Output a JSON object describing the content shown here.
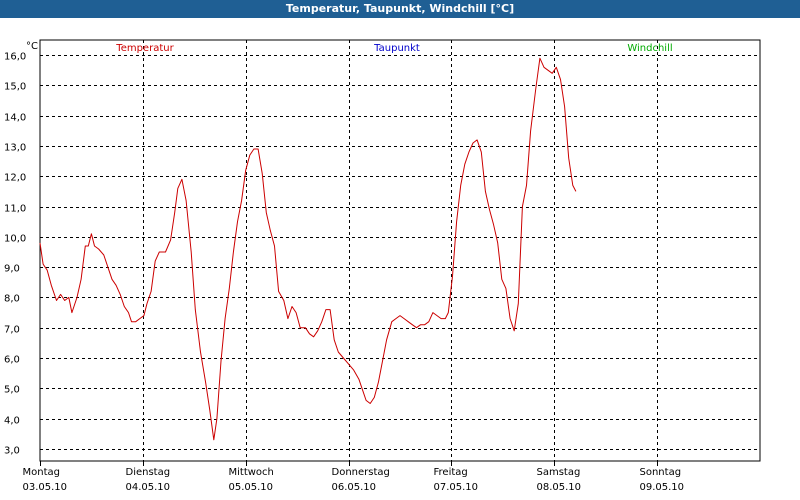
{
  "window": {
    "title": "Temperatur, Taupunkt, Windchill [°C]"
  },
  "colors": {
    "title_bar": "#1f5f94",
    "title_text": "#ffffff",
    "grid": "#000000",
    "temperatur": "#cc0000",
    "taupunkt": "#0000cc",
    "windchill": "#00aa00"
  },
  "chart_data": {
    "type": "line",
    "title": "Temperatur, Taupunkt, Windchill [°C]",
    "ylabel": "°C",
    "ylim": [
      2.6,
      16.5
    ],
    "yticks": [
      "3,0",
      "4,0",
      "5,0",
      "6,0",
      "7,0",
      "8,0",
      "9,0",
      "10,0",
      "11,0",
      "12,0",
      "13,0",
      "14,0",
      "15,0",
      "16,0"
    ],
    "ytick_values": [
      3,
      4,
      5,
      6,
      7,
      8,
      9,
      10,
      11,
      12,
      13,
      14,
      15,
      16
    ],
    "xlim": [
      0,
      7
    ],
    "xticks": [
      {
        "day": "Montag",
        "date": "03.05.10"
      },
      {
        "day": "Dienstag",
        "date": "04.05.10"
      },
      {
        "day": "Mittwoch",
        "date": "05.05.10"
      },
      {
        "day": "Donnerstag",
        "date": "06.05.10"
      },
      {
        "day": "Freitag",
        "date": "07.05.10"
      },
      {
        "day": "Samstag",
        "date": "08.05.10"
      },
      {
        "day": "Sonntag",
        "date": "09.05.10"
      }
    ],
    "legend": [
      {
        "name": "Temperatur",
        "color": "#cc0000"
      },
      {
        "name": "Taupunkt",
        "color": "#0000cc"
      },
      {
        "name": "Windchill",
        "color": "#00aa00"
      }
    ],
    "grid": true,
    "series": [
      {
        "name": "Temperatur",
        "color": "#cc0000",
        "x_unit": "days since Montag 03.05.10 00:00",
        "points": [
          [
            0.0,
            9.8
          ],
          [
            0.03,
            9.1
          ],
          [
            0.07,
            8.9
          ],
          [
            0.11,
            8.4
          ],
          [
            0.16,
            7.9
          ],
          [
            0.2,
            8.1
          ],
          [
            0.24,
            7.9
          ],
          [
            0.28,
            8.0
          ],
          [
            0.31,
            7.5
          ],
          [
            0.36,
            8.0
          ],
          [
            0.4,
            8.6
          ],
          [
            0.44,
            9.7
          ],
          [
            0.47,
            9.7
          ],
          [
            0.5,
            10.1
          ],
          [
            0.53,
            9.7
          ],
          [
            0.57,
            9.6
          ],
          [
            0.62,
            9.4
          ],
          [
            0.66,
            9.0
          ],
          [
            0.7,
            8.6
          ],
          [
            0.74,
            8.4
          ],
          [
            0.78,
            8.1
          ],
          [
            0.82,
            7.7
          ],
          [
            0.86,
            7.5
          ],
          [
            0.89,
            7.2
          ],
          [
            0.93,
            7.2
          ],
          [
            0.97,
            7.3
          ],
          [
            1.01,
            7.4
          ],
          [
            1.04,
            7.8
          ],
          [
            1.08,
            8.2
          ],
          [
            1.12,
            9.2
          ],
          [
            1.16,
            9.5
          ],
          [
            1.22,
            9.5
          ],
          [
            1.27,
            9.9
          ],
          [
            1.31,
            10.8
          ],
          [
            1.34,
            11.6
          ],
          [
            1.38,
            11.9
          ],
          [
            1.42,
            11.2
          ],
          [
            1.47,
            9.5
          ],
          [
            1.51,
            7.6
          ],
          [
            1.56,
            6.2
          ],
          [
            1.61,
            5.2
          ],
          [
            1.65,
            4.3
          ],
          [
            1.69,
            3.3
          ],
          [
            1.72,
            4.0
          ],
          [
            1.76,
            5.9
          ],
          [
            1.8,
            7.3
          ],
          [
            1.84,
            8.3
          ],
          [
            1.88,
            9.5
          ],
          [
            1.92,
            10.5
          ],
          [
            1.96,
            11.2
          ],
          [
            2.0,
            12.2
          ],
          [
            2.04,
            12.7
          ],
          [
            2.08,
            12.9
          ],
          [
            2.12,
            12.9
          ],
          [
            2.16,
            12.1
          ],
          [
            2.2,
            10.8
          ],
          [
            2.24,
            10.2
          ],
          [
            2.28,
            9.7
          ],
          [
            2.32,
            8.2
          ],
          [
            2.37,
            7.9
          ],
          [
            2.41,
            7.3
          ],
          [
            2.45,
            7.7
          ],
          [
            2.49,
            7.5
          ],
          [
            2.53,
            7.0
          ],
          [
            2.58,
            7.0
          ],
          [
            2.62,
            6.8
          ],
          [
            2.66,
            6.7
          ],
          [
            2.7,
            6.9
          ],
          [
            2.74,
            7.2
          ],
          [
            2.78,
            7.6
          ],
          [
            2.82,
            7.6
          ],
          [
            2.86,
            6.6
          ],
          [
            2.9,
            6.2
          ],
          [
            2.95,
            6.0
          ],
          [
            3.0,
            5.8
          ],
          [
            3.05,
            5.6
          ],
          [
            3.1,
            5.3
          ],
          [
            3.14,
            4.9
          ],
          [
            3.17,
            4.6
          ],
          [
            3.21,
            4.5
          ],
          [
            3.25,
            4.7
          ],
          [
            3.29,
            5.2
          ],
          [
            3.33,
            5.9
          ],
          [
            3.37,
            6.6
          ],
          [
            3.42,
            7.2
          ],
          [
            3.46,
            7.3
          ],
          [
            3.5,
            7.4
          ],
          [
            3.54,
            7.3
          ],
          [
            3.58,
            7.2
          ],
          [
            3.62,
            7.1
          ],
          [
            3.66,
            7.0
          ],
          [
            3.7,
            7.1
          ],
          [
            3.74,
            7.1
          ],
          [
            3.78,
            7.2
          ],
          [
            3.82,
            7.5
          ],
          [
            3.86,
            7.4
          ],
          [
            3.9,
            7.3
          ],
          [
            3.94,
            7.3
          ],
          [
            3.97,
            7.5
          ],
          [
            4.01,
            8.7
          ],
          [
            4.05,
            10.5
          ],
          [
            4.09,
            11.7
          ],
          [
            4.13,
            12.4
          ],
          [
            4.17,
            12.8
          ],
          [
            4.21,
            13.1
          ],
          [
            4.25,
            13.2
          ],
          [
            4.29,
            12.8
          ],
          [
            4.33,
            11.5
          ],
          [
            4.37,
            10.9
          ],
          [
            4.41,
            10.4
          ],
          [
            4.45,
            9.8
          ],
          [
            4.49,
            8.6
          ],
          [
            4.53,
            8.3
          ],
          [
            4.57,
            7.3
          ],
          [
            4.61,
            6.9
          ],
          [
            4.65,
            7.8
          ],
          [
            4.69,
            11.0
          ],
          [
            4.73,
            11.7
          ],
          [
            4.77,
            13.5
          ],
          [
            4.82,
            14.9
          ],
          [
            4.86,
            15.9
          ],
          [
            4.9,
            15.6
          ],
          [
            4.94,
            15.5
          ],
          [
            4.98,
            15.4
          ],
          [
            5.02,
            15.6
          ],
          [
            5.06,
            15.2
          ],
          [
            5.1,
            14.3
          ],
          [
            5.14,
            12.6
          ],
          [
            5.18,
            11.7
          ],
          [
            5.21,
            11.5
          ]
        ]
      },
      {
        "name": "Taupunkt",
        "color": "#0000cc",
        "points": []
      },
      {
        "name": "Windchill",
        "color": "#00aa00",
        "points": []
      }
    ]
  }
}
